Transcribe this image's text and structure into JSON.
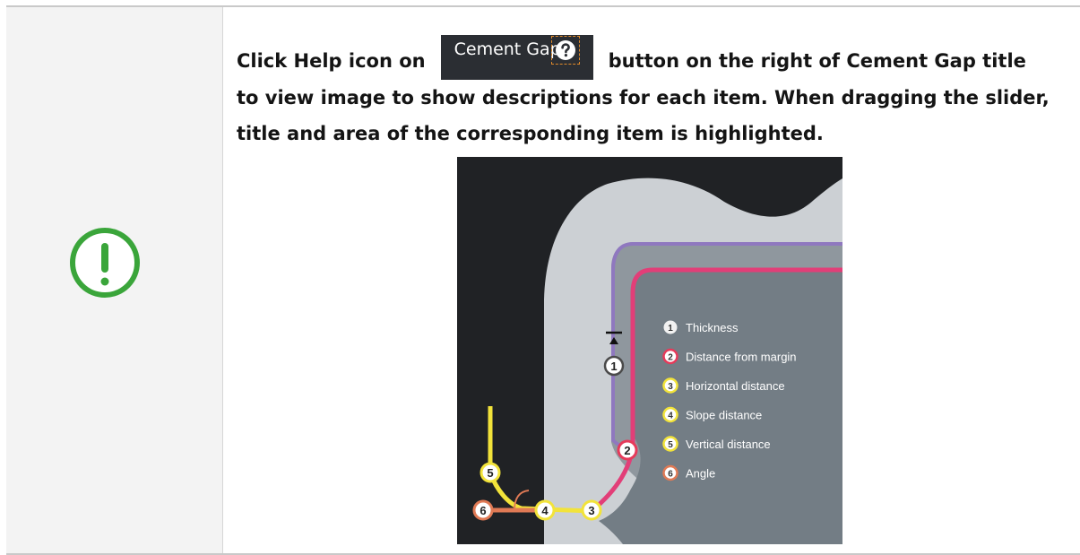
{
  "instruction": {
    "line1_prefix": "Click Help icon on",
    "button_label": "Cement Gap",
    "line1_suffix": "button on the right of Cement Gap title",
    "line2": "to view image to show descriptions for each item. When dragging the slider,",
    "line3": "title and area of the corresponding item is highlighted."
  },
  "legend": [
    {
      "num": "1",
      "label": "Thickness"
    },
    {
      "num": "2",
      "label": "Distance from margin"
    },
    {
      "num": "3",
      "label": "Horizontal distance"
    },
    {
      "num": "4",
      "label": "Slope distance"
    },
    {
      "num": "5",
      "label": "Vertical distance"
    },
    {
      "num": "6",
      "label": "Angle"
    }
  ],
  "markers": {
    "m1": "1",
    "m2": "2",
    "m3": "3",
    "m4": "4",
    "m5": "5",
    "m6": "6"
  },
  "colors": {
    "alert_green": "#3aa53a",
    "thickness": "#ffffff",
    "margin": "#e63a5a",
    "horizontal": "#f2e33a",
    "slope": "#f2e33a",
    "vertical": "#f2e33a",
    "angle": "#e07a55",
    "outer_line": "#8f78bf",
    "inner_line": "#e23e78"
  }
}
